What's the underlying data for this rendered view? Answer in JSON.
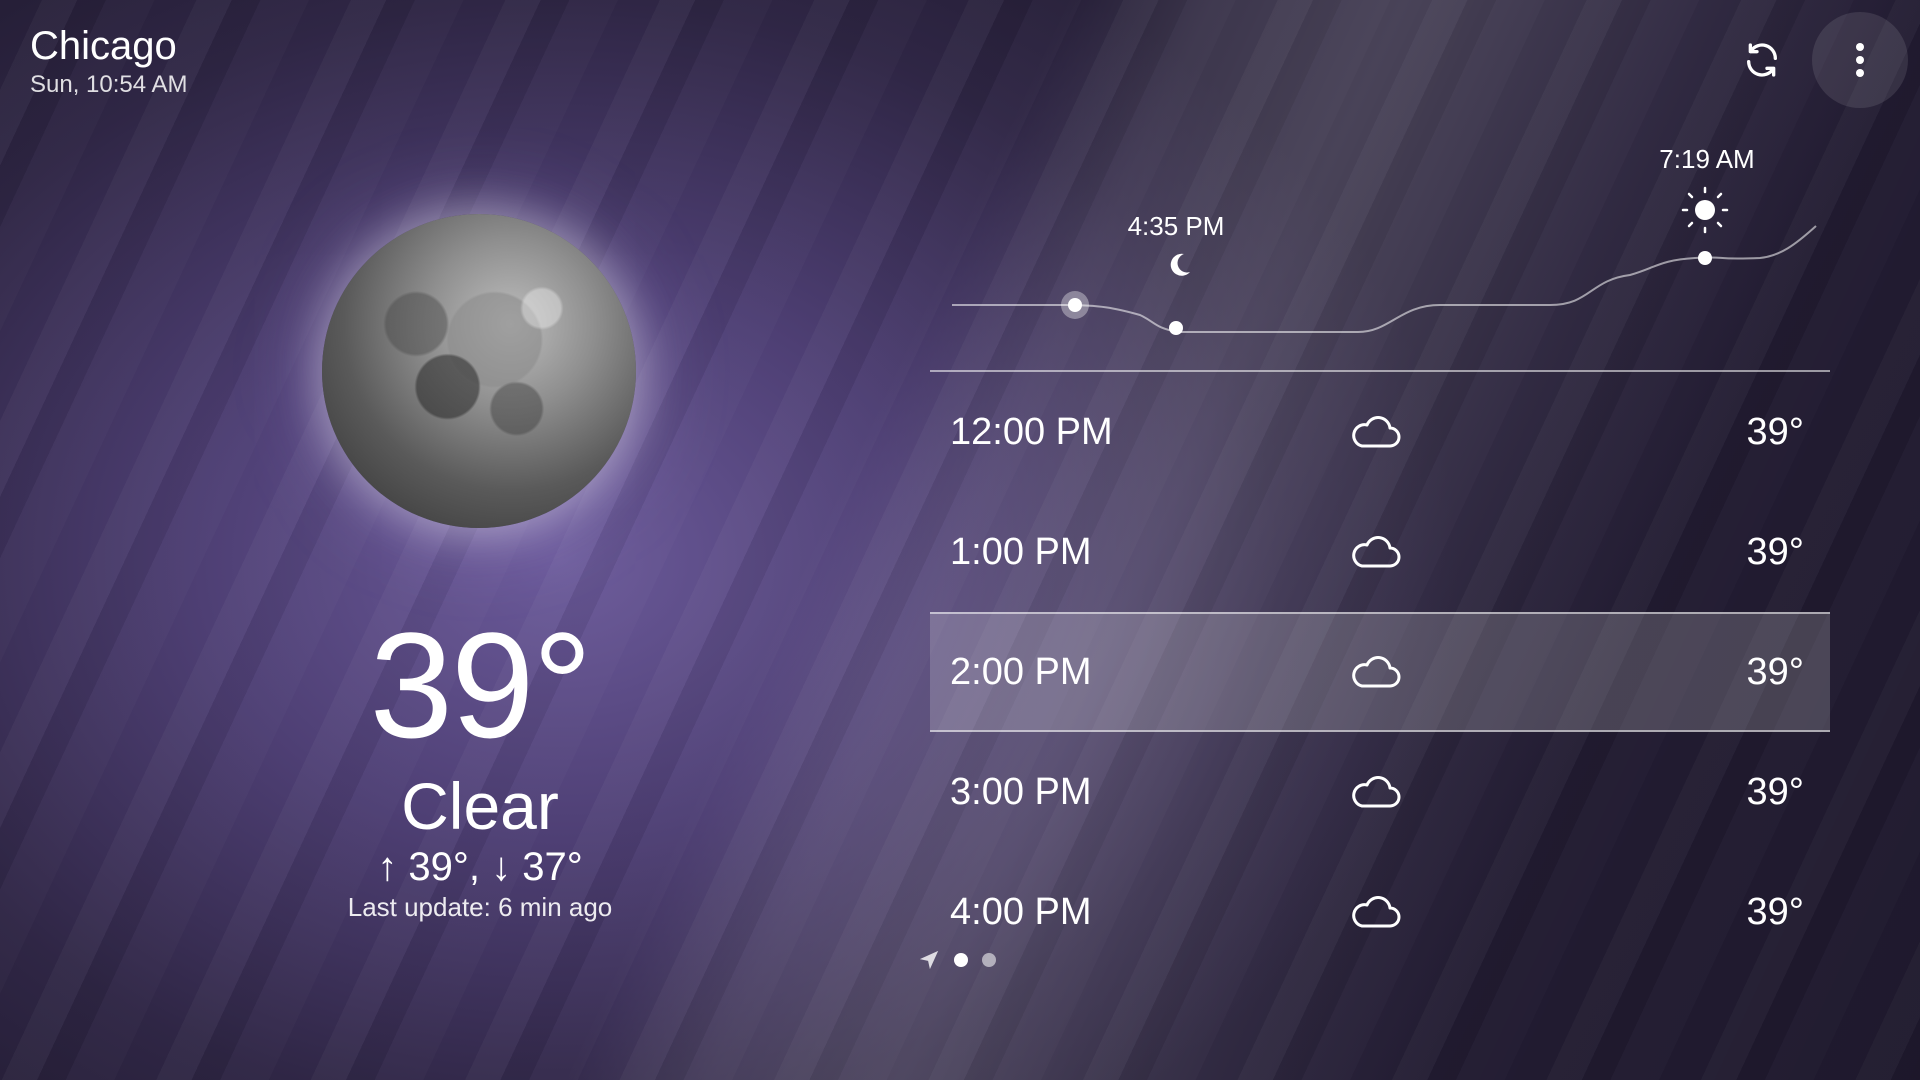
{
  "header": {
    "city": "Chicago",
    "datetime": "Sun, 10:54 AM",
    "refresh_icon": "refresh-icon",
    "menu_icon": "more-vert-icon"
  },
  "current": {
    "icon": "moon-icon",
    "temperature": "39°",
    "condition": "Clear",
    "high_low": "↑ 39°, ↓ 37°",
    "last_update": "Last update: 6 min ago"
  },
  "sun_chart": {
    "sunset_time": "4:35 PM",
    "sunrise_time": "7:19 AM",
    "sunset_icon": "moon-icon",
    "sunrise_icon": "sun-icon"
  },
  "hourly": [
    {
      "time": "12:00 PM",
      "icon": "cloud-icon",
      "temp": "39°"
    },
    {
      "time": "1:00 PM",
      "icon": "cloud-icon",
      "temp": "39°"
    },
    {
      "time": "2:00 PM",
      "icon": "cloud-icon",
      "temp": "39°",
      "selected": true
    },
    {
      "time": "3:00 PM",
      "icon": "cloud-icon",
      "temp": "39°"
    },
    {
      "time": "4:00 PM",
      "icon": "cloud-icon",
      "temp": "39°"
    }
  ],
  "pager": {
    "location_icon": "navigation-arrow-icon",
    "pages": 2,
    "active_page": 1
  },
  "colors": {
    "background_top": "#2f2645",
    "background_glow": "#6b5a9a",
    "text": "#ffffff"
  }
}
